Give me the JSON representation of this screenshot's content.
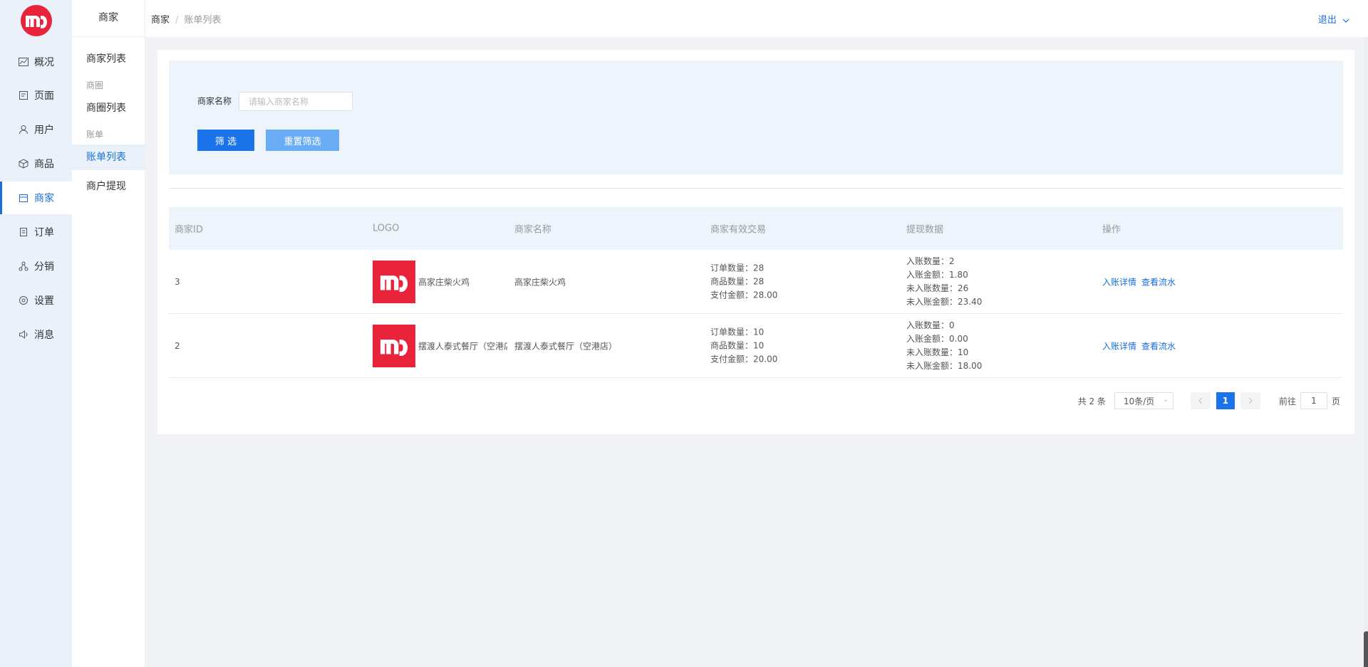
{
  "colors": {
    "brand_red": "#e8233a",
    "accent_blue": "#1a73e8",
    "link_blue": "#1a6fd8"
  },
  "rail": {
    "items": [
      {
        "label": "概况",
        "icon": "chart-line-icon"
      },
      {
        "label": "页面",
        "icon": "page-icon"
      },
      {
        "label": "用户",
        "icon": "user-icon"
      },
      {
        "label": "商品",
        "icon": "box-icon"
      },
      {
        "label": "商家",
        "icon": "store-icon",
        "active": true
      },
      {
        "label": "订单",
        "icon": "order-icon"
      },
      {
        "label": "分销",
        "icon": "network-icon"
      },
      {
        "label": "设置",
        "icon": "gear-icon"
      },
      {
        "label": "消息",
        "icon": "speaker-icon"
      }
    ]
  },
  "submenu": {
    "title": "商家",
    "items": [
      {
        "label": "商家列表"
      },
      {
        "group": "商圈"
      },
      {
        "label": "商圈列表"
      },
      {
        "group": "账单"
      },
      {
        "label": "账单列表",
        "active": true
      },
      {
        "label": "商户提现"
      }
    ]
  },
  "topbar": {
    "breadcrumb": [
      "商家",
      "账单列表"
    ],
    "logout_label": "退出"
  },
  "filter": {
    "name_label": "商家名称",
    "name_placeholder": "请输入商家名称",
    "name_value": "",
    "filter_button": "筛 选",
    "reset_button": "重置筛选"
  },
  "table": {
    "headers": [
      "商家ID",
      "LOGO",
      "商家名称",
      "商家有效交易",
      "提现数据",
      "操作"
    ],
    "rows": [
      {
        "id": "3",
        "logo_store_name": "高家庄柴火鸡",
        "name": "高家庄柴火鸡",
        "trade": [
          "订单数量：28",
          "商品数量：28",
          "支付金额：28.00"
        ],
        "withdraw": [
          "入账数量：2",
          "入账金额：1.80",
          "未入账数量：26",
          "未入账金额：23.40"
        ],
        "actions": [
          "入账详情",
          "查看流水"
        ]
      },
      {
        "id": "2",
        "logo_store_name": "摆渡人泰式餐厅（空港店）",
        "name": "摆渡人泰式餐厅（空港店）",
        "trade": [
          "订单数量：10",
          "商品数量：10",
          "支付金额：20.00"
        ],
        "withdraw": [
          "入账数量：0",
          "入账金额：0.00",
          "未入账数量：10",
          "未入账金额：18.00"
        ],
        "actions": [
          "入账详情",
          "查看流水"
        ]
      }
    ]
  },
  "pagination": {
    "total": "共 2 条",
    "page_size": "10条/页",
    "current_page": "1",
    "goto_label": "前往",
    "goto_value": "1",
    "page_suffix": "页"
  }
}
